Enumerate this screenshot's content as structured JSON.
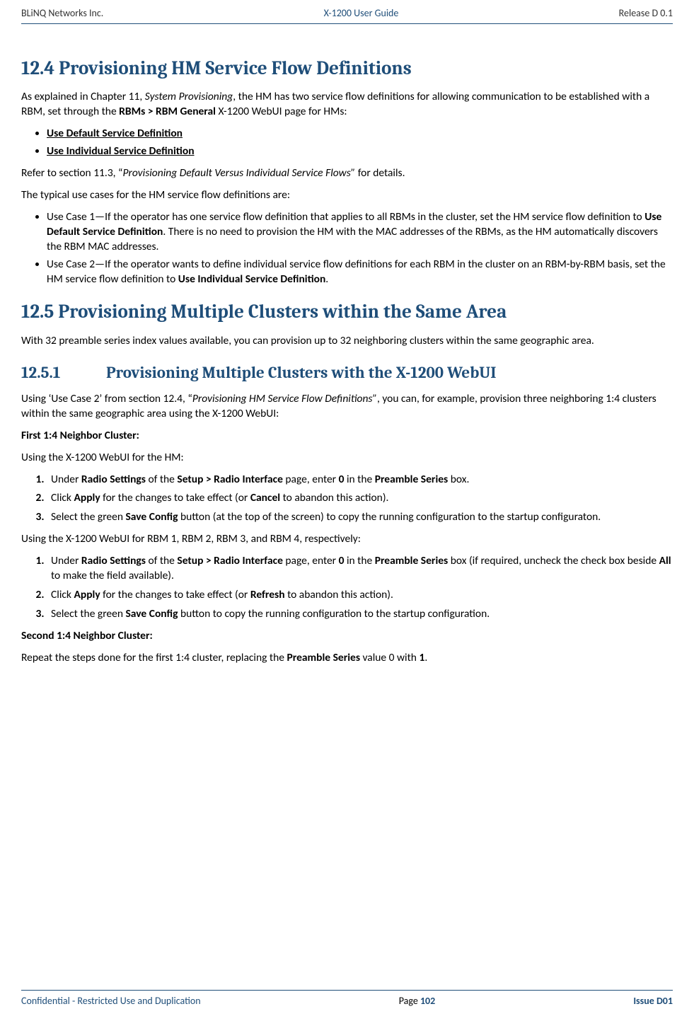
{
  "header": {
    "left": "BLiNQ Networks Inc.",
    "center": "X-1200 User Guide",
    "right": "Release D 0.1"
  },
  "s124": {
    "title": "12.4 Provisioning HM Service Flow Definitions",
    "p1a": "As explained in Chapter 11, ",
    "p1b": "System Provisioning",
    "p1c": ", the HM has two service flow definitions for allowing communication to be established with a RBM, set through the ",
    "p1d": "RBMs > RBM General",
    "p1e": " X-1200 WebUI page for HMs:",
    "bullet1": "Use Default Service Definition",
    "bullet2": "Use Individual Service Definition",
    "p2a": "Refer to section 11.3, “",
    "p2b": "Provisioning Default Versus Individual Service Flows”",
    "p2c": " for details.",
    "p3": "The typical use cases for the HM service flow definitions are:",
    "uc1a": "Use Case 1—If the operator has one service flow definition that applies to all RBMs in the cluster, set the HM service flow definition to ",
    "uc1b": "Use Default Service Definition",
    "uc1c": ". There is no need to provision the HM with the MAC addresses of the RBMs, as the HM automatically discovers the RBM MAC addresses.",
    "uc2a": "Use Case 2—If the operator wants to define individual service flow definitions for each RBM in the cluster on an RBM-by-RBM basis, set the HM service flow definition to ",
    "uc2b": "Use Individual Service Definition",
    "uc2c": "."
  },
  "s125": {
    "title": "12.5 Provisioning Multiple Clusters within the Same Area",
    "p1": "With 32 preamble series index values available, you can provision up to 32 neighboring clusters within the same geographic area."
  },
  "s1251": {
    "num": "12.5.1",
    "title": "Provisioning Multiple Clusters with the X-1200 WebUI",
    "p1a": "Using ‘Use Case 2’ from section 12.4, “",
    "p1b": "Provisioning HM Service Flow Definitions”",
    "p1c": ", you can, for example, provision three neighboring 1:4 clusters within the same geographic area using the X-1200 WebUI:",
    "h1": "First 1:4 Neighbor Cluster:",
    "p2": "Using the X-1200 WebUI for the HM:",
    "ol1": {
      "i1a": "Under ",
      "i1b": "Radio Settings",
      "i1c": " of the ",
      "i1d": "Setup > Radio Interface",
      "i1e": " page, enter ",
      "i1f": "0",
      "i1g": " in the ",
      "i1h": "Preamble Series",
      "i1i": " box.",
      "i2a": "Click ",
      "i2b": "Apply",
      "i2c": " for the changes to take effect (or ",
      "i2d": "Cancel",
      "i2e": " to abandon this action).",
      "i3a": "Select the green ",
      "i3b": "Save Config",
      "i3c": " button (at the top of the screen) to copy the running configuration to the startup configuraton."
    },
    "p3": "Using the X-1200 WebUI for RBM 1, RBM 2, RBM 3, and RBM 4, respectively:",
    "ol2": {
      "i1a": "Under ",
      "i1b": "Radio Settings",
      "i1c": " of the ",
      "i1d": "Setup > Radio Interface",
      "i1e": " page, enter ",
      "i1f": "0",
      "i1g": " in the ",
      "i1h": "Preamble Series",
      "i1i": " box (if required, uncheck the check box beside ",
      "i1j": "All",
      "i1k": " to make the field available).",
      "i2a": "Click ",
      "i2b": "Apply",
      "i2c": " for the changes to take effect (or ",
      "i2d": "Refresh",
      "i2e": " to abandon this action).",
      "i3a": "Select the green ",
      "i3b": "Save Config",
      "i3c": " button to copy the running configuration to the startup configuration."
    },
    "h2": "Second 1:4 Neighbor Cluster:",
    "p4a": "Repeat the steps done for the first 1:4 cluster, replacing the ",
    "p4b": "Preamble Series",
    "p4c": " value 0 with ",
    "p4d": "1",
    "p4e": "."
  },
  "footer": {
    "left": "Confidential - Restricted Use and Duplication",
    "page_label": "Page ",
    "page_num": "102",
    "right": "Issue D01"
  }
}
